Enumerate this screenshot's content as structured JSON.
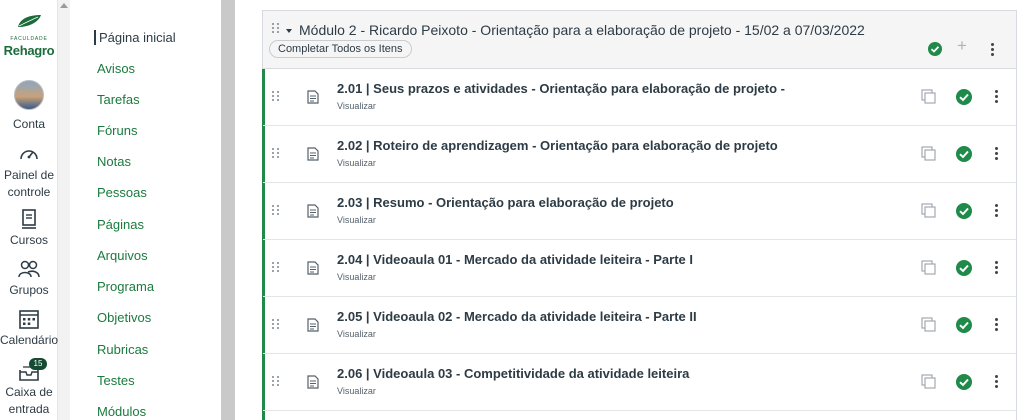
{
  "global_nav": {
    "logo": {
      "faculty": "FACULDADE",
      "brand": "Rehagro"
    },
    "items": [
      {
        "label": "Conta",
        "icon": "avatar"
      },
      {
        "label": "Painel de controle",
        "icon": "dashboard-icon"
      },
      {
        "label": "Cursos",
        "icon": "courses-icon"
      },
      {
        "label": "Grupos",
        "icon": "groups-icon"
      },
      {
        "label": "Calendário",
        "icon": "calendar-icon"
      },
      {
        "label": "Caixa de entrada",
        "icon": "inbox-icon",
        "badge": "15"
      }
    ]
  },
  "course_nav": {
    "items": [
      {
        "label": "Página inicial",
        "active": true
      },
      {
        "label": "Avisos"
      },
      {
        "label": "Tarefas"
      },
      {
        "label": "Fóruns"
      },
      {
        "label": "Notas"
      },
      {
        "label": "Pessoas"
      },
      {
        "label": "Páginas"
      },
      {
        "label": "Arquivos"
      },
      {
        "label": "Programa"
      },
      {
        "label": "Objetivos"
      },
      {
        "label": "Rubricas"
      },
      {
        "label": "Testes"
      },
      {
        "label": "Módulos"
      }
    ]
  },
  "module": {
    "title": "Módulo 2 - Ricardo Peixoto - Orientação para a elaboração de projeto - 15/02 a 07/03/2022",
    "complete_all_label": "Completar Todos os Itens",
    "items": [
      {
        "title": "2.01 | Seus prazos e atividades - Orientação para elaboração de projeto -",
        "subtitle": "Visualizar"
      },
      {
        "title": "2.02 | Roteiro de aprendizagem - Orientação para elaboração de projeto",
        "subtitle": "Visualizar"
      },
      {
        "title": "2.03 | Resumo - Orientação para elaboração de projeto",
        "subtitle": "Visualizar"
      },
      {
        "title": "2.04 | Videoaula 01 - Mercado da atividade leiteira - Parte I",
        "subtitle": "Visualizar"
      },
      {
        "title": "2.05 | Videoaula 02 - Mercado da atividade leiteira - Parte II",
        "subtitle": "Visualizar"
      },
      {
        "title": "2.06 | Videoaula 03 - Competitividade da atividade leiteira",
        "subtitle": "Visualizar"
      }
    ]
  },
  "colors": {
    "brand_green": "#1d6b3a",
    "link_green": "#1b7a3e",
    "complete_green": "#1f8a49",
    "text": "#2d3b45"
  }
}
